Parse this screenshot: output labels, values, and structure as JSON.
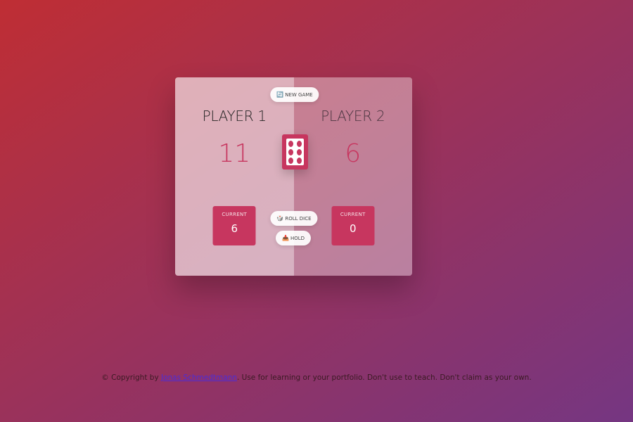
{
  "players": [
    {
      "name": "PLAYER 1",
      "score": "11",
      "current_label": "CURRENT",
      "current": "6",
      "active": true
    },
    {
      "name": "PLAYER 2",
      "score": "6",
      "current_label": "CURRENT",
      "current": "0",
      "active": false
    }
  ],
  "buttons": {
    "new_game": {
      "label": "NEW GAME",
      "icon": "🔄"
    },
    "roll_dice": {
      "label": "ROLL DICE",
      "icon": "🎲"
    },
    "hold": {
      "label": "HOLD",
      "icon": "📥"
    }
  },
  "dice": {
    "value": 6,
    "color": "#c7365f"
  },
  "footer": {
    "prefix": "© Copyright by ",
    "author_link": "Jonas Schmedtmann",
    "suffix": ". Use for learning or your portfolio. Don't use to teach. Don't claim as your own."
  },
  "colors": {
    "accent": "#c7365f",
    "bg_start": "#bf2e34",
    "bg_end": "#753682"
  }
}
